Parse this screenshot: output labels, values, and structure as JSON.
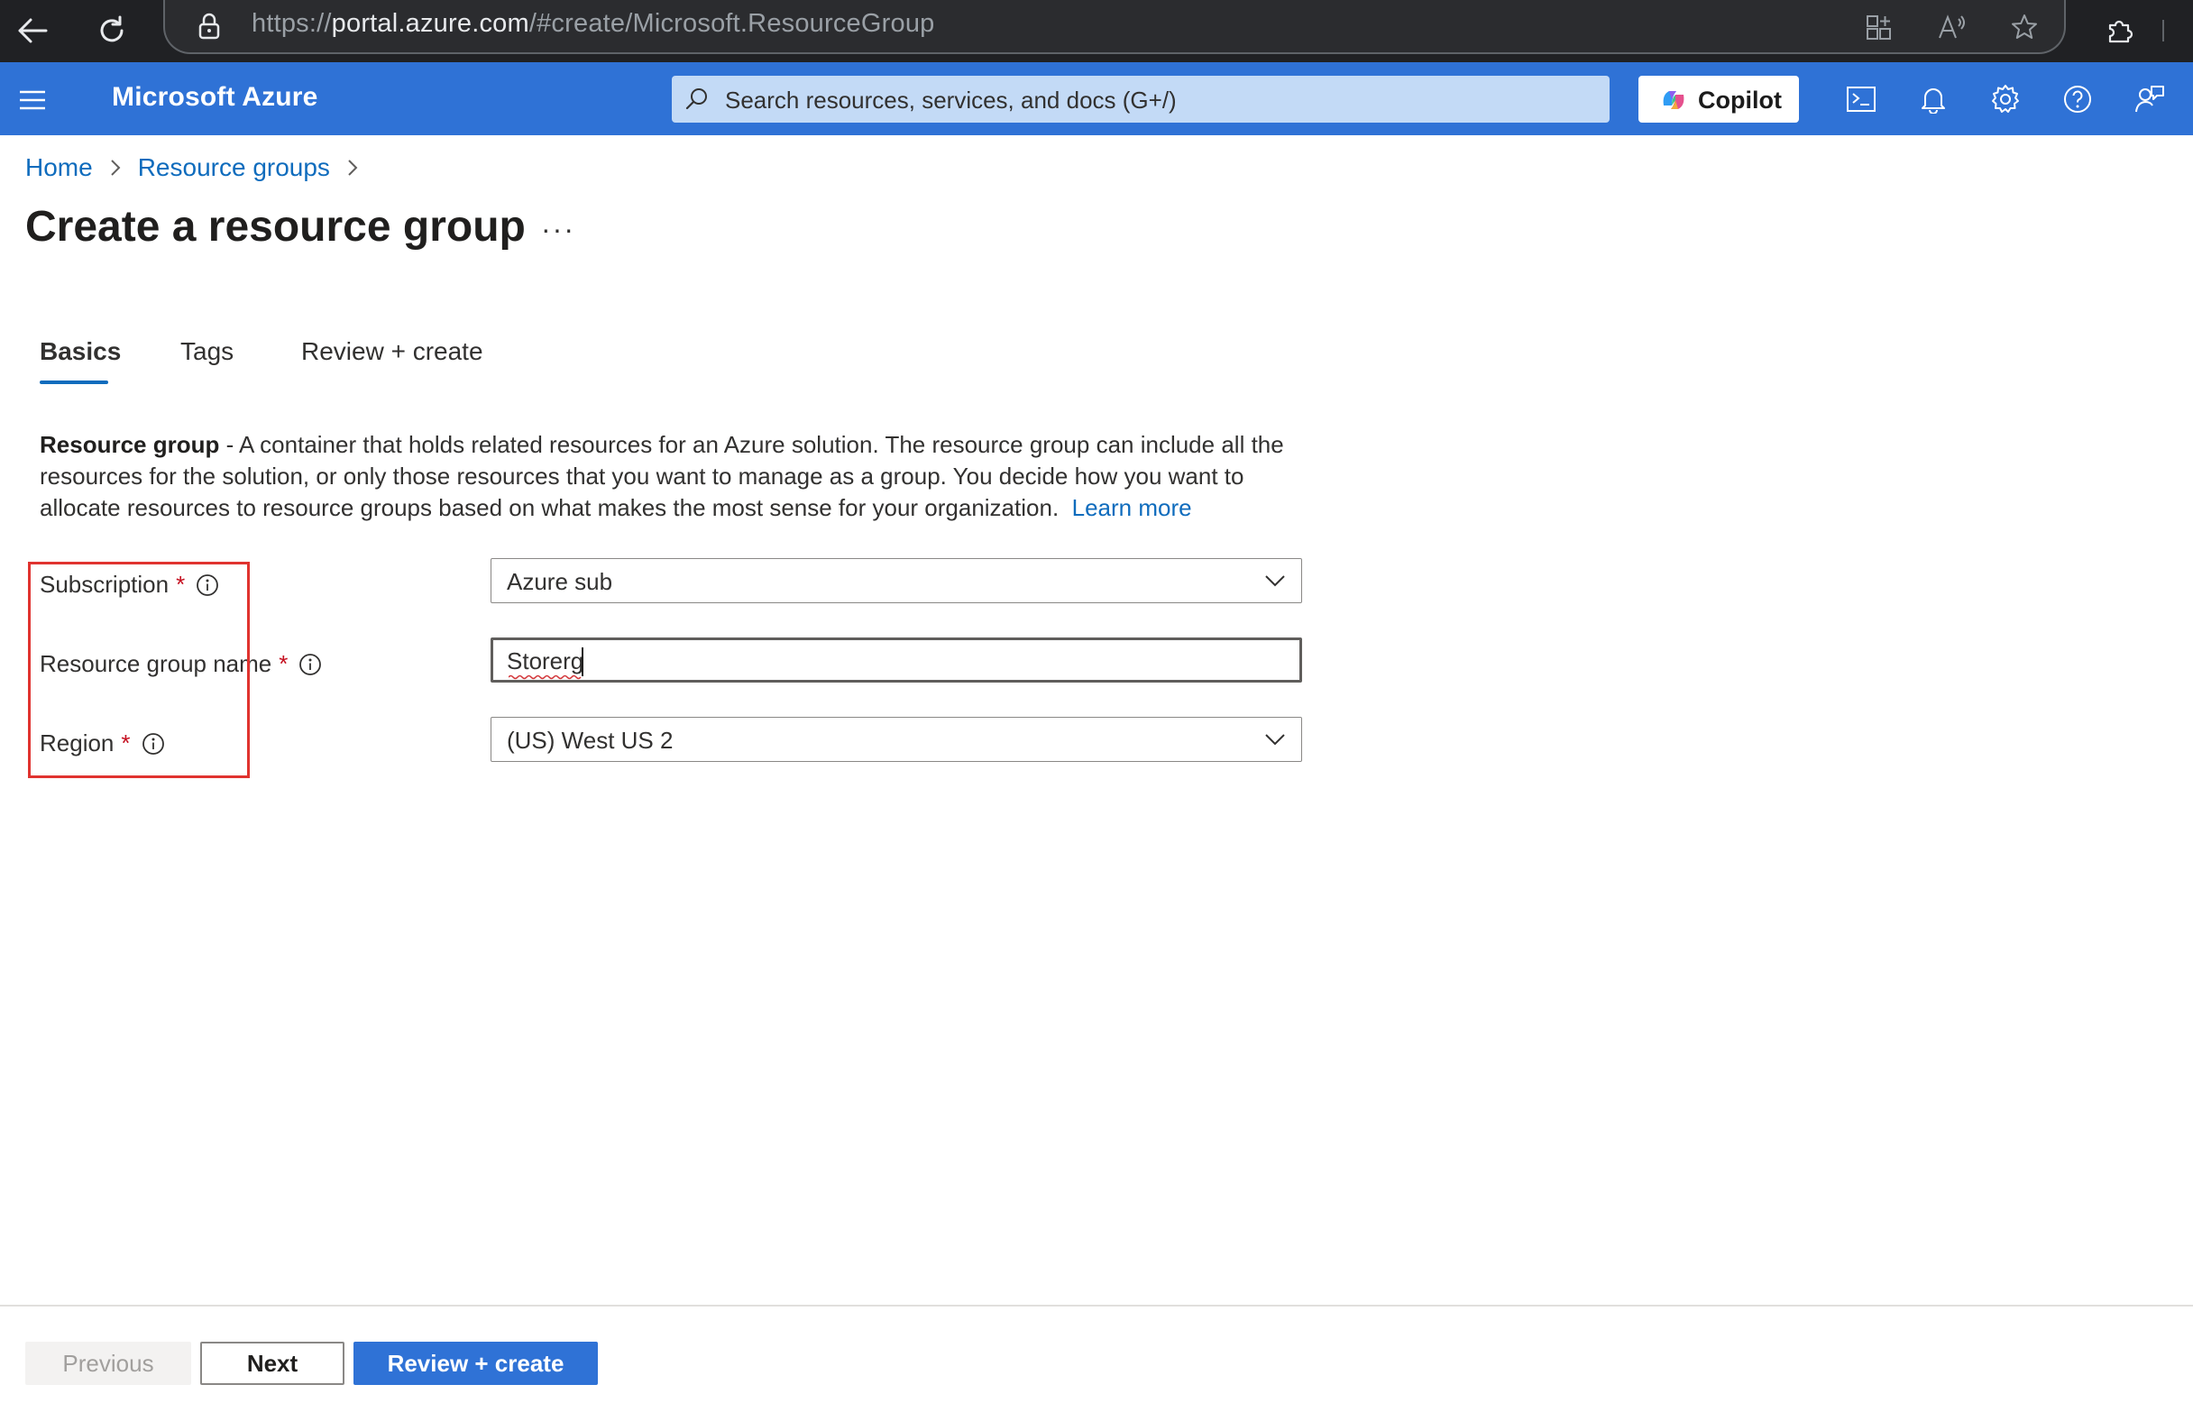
{
  "browser": {
    "url_prefix": "https://",
    "url_host": "portal.azure.com",
    "url_path": "/#create/Microsoft.ResourceGroup"
  },
  "header": {
    "brand": "Microsoft Azure",
    "search_placeholder": "Search resources, services, and docs (G+/)",
    "copilot_label": "Copilot",
    "accent_color": "#2f72d6"
  },
  "breadcrumb": {
    "items": [
      "Home",
      "Resource groups"
    ]
  },
  "page": {
    "title": "Create a resource group",
    "more": "···"
  },
  "tabs": [
    {
      "label": "Basics",
      "active": true
    },
    {
      "label": "Tags",
      "active": false
    },
    {
      "label": "Review + create",
      "active": false
    }
  ],
  "description": {
    "bold": "Resource group",
    "text": " - A container that holds related resources for an Azure solution. The resource group can include all the resources for the solution, or only those resources that you want to manage as a group. You decide how you want to allocate resources to resource groups based on what makes the most sense for your organization.",
    "link": "Learn more"
  },
  "form": {
    "subscription": {
      "label": "Subscription",
      "required": "*",
      "value": "Azure sub"
    },
    "resource_group_name": {
      "label": "Resource group name",
      "required": "*",
      "value": "Storerg"
    },
    "region": {
      "label": "Region",
      "required": "*",
      "value": "(US) West US 2"
    }
  },
  "footer": {
    "previous": "Previous",
    "next": "Next",
    "review_create": "Review + create"
  },
  "icons": {
    "browser": [
      "back-icon",
      "refresh-icon",
      "lock-icon",
      "split-screen-icon",
      "read-aloud-icon",
      "favorite-icon",
      "extensions-icon"
    ],
    "header": [
      "hamburger-icon",
      "search-icon",
      "copilot-icon",
      "cloud-shell-icon",
      "bell-icon",
      "gear-icon",
      "help-icon",
      "feedback-icon"
    ]
  }
}
